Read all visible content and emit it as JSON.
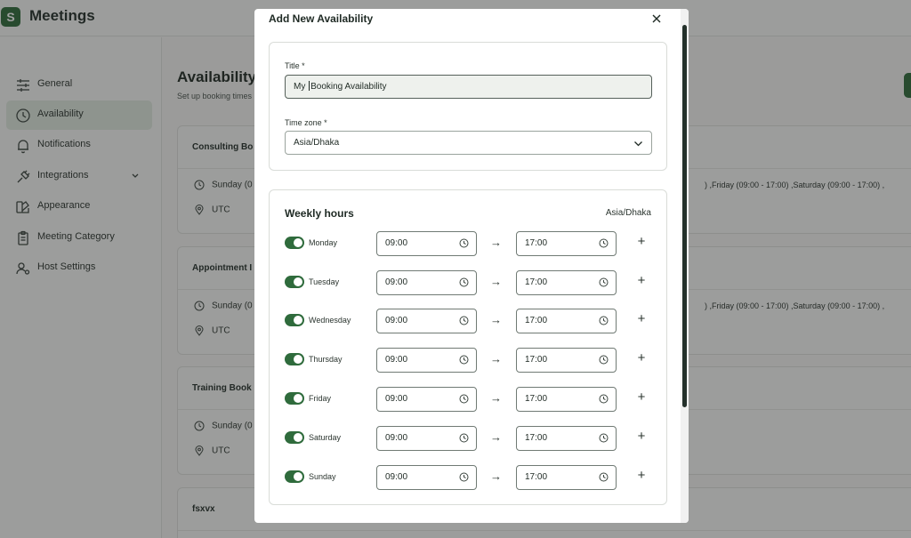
{
  "app": {
    "title": "Meetings"
  },
  "sidebar": {
    "items": [
      {
        "label": "General",
        "icon": "sliders-icon",
        "active": false
      },
      {
        "label": "Availability",
        "icon": "clock-icon",
        "active": true
      },
      {
        "label": "Notifications",
        "icon": "bell-icon",
        "active": false
      },
      {
        "label": "Integrations",
        "icon": "plug-icon",
        "active": false,
        "expandable": true
      },
      {
        "label": "Appearance",
        "icon": "palette-icon",
        "active": false
      },
      {
        "label": "Meeting Category",
        "icon": "clipboard-icon",
        "active": false
      },
      {
        "label": "Host Settings",
        "icon": "user-gear-icon",
        "active": false
      }
    ]
  },
  "main": {
    "title": "Availability",
    "subtitle": "Set up booking times",
    "cards": [
      {
        "title": "Consulting Bo",
        "days_start": "Sunday (0",
        "days_end": ") ,Friday (09:00 - 17:00) ,Saturday (09:00 - 17:00) ,",
        "timezone": "UTC"
      },
      {
        "title": "Appointment I",
        "days_start": "Sunday (0",
        "days_end": ") ,Friday (09:00 - 17:00) ,Saturday (09:00 - 17:00) ,",
        "timezone": "UTC"
      },
      {
        "title": "Training Book",
        "days_start": "Sunday (0",
        "days_end": "",
        "timezone": "UTC"
      },
      {
        "title": "fsxvx",
        "days_start": "",
        "days_end": "",
        "timezone": ""
      }
    ]
  },
  "modal": {
    "title": "Add New Availability",
    "title_label": "Title *",
    "title_value_before": "My ",
    "title_value_after": "Booking Availability",
    "timezone_label": "Time zone *",
    "timezone_value": "Asia/Dhaka",
    "weekly_title": "Weekly hours",
    "weekly_timezone": "Asia/Dhaka",
    "days": [
      {
        "name": "Monday",
        "enabled": true,
        "start": "09:00",
        "end": "17:00"
      },
      {
        "name": "Tuesday",
        "enabled": true,
        "start": "09:00",
        "end": "17:00"
      },
      {
        "name": "Wednesday",
        "enabled": true,
        "start": "09:00",
        "end": "17:00"
      },
      {
        "name": "Thursday",
        "enabled": true,
        "start": "09:00",
        "end": "17:00"
      },
      {
        "name": "Friday",
        "enabled": true,
        "start": "09:00",
        "end": "17:00"
      },
      {
        "name": "Saturday",
        "enabled": true,
        "start": "09:00",
        "end": "17:00"
      },
      {
        "name": "Sunday",
        "enabled": true,
        "start": "09:00",
        "end": "17:00"
      }
    ],
    "arrow_glyph": "→",
    "add_glyph": "+"
  },
  "colors": {
    "brand": "#2f6b3c",
    "active_nav": "#dfe9df"
  }
}
